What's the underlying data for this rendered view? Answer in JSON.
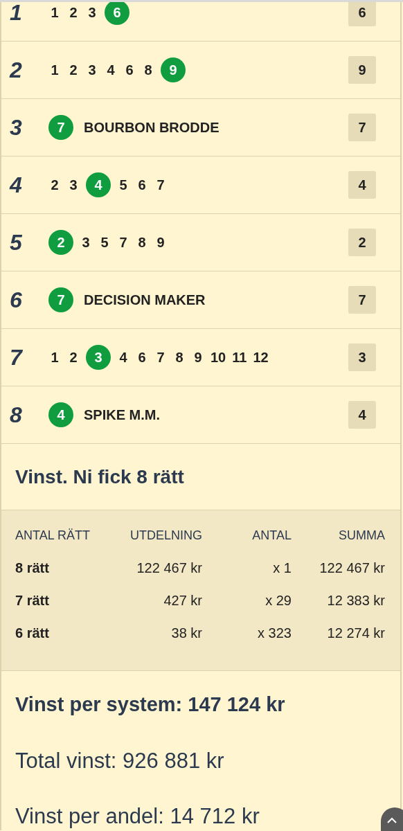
{
  "legs": [
    {
      "number": "1",
      "picks": [
        {
          "label": "1",
          "winner": false
        },
        {
          "label": "2",
          "winner": false
        },
        {
          "label": "3",
          "winner": false
        },
        {
          "label": "6",
          "winner": true
        }
      ],
      "result": "6"
    },
    {
      "number": "2",
      "picks": [
        {
          "label": "1",
          "winner": false
        },
        {
          "label": "2",
          "winner": false
        },
        {
          "label": "3",
          "winner": false
        },
        {
          "label": "4",
          "winner": false
        },
        {
          "label": "6",
          "winner": false
        },
        {
          "label": "8",
          "winner": false
        },
        {
          "label": "9",
          "winner": true
        }
      ],
      "result": "9"
    },
    {
      "number": "3",
      "picks": [
        {
          "label": "7",
          "winner": true
        }
      ],
      "horse": "BOURBON BRODDE",
      "result": "7"
    },
    {
      "number": "4",
      "picks": [
        {
          "label": "2",
          "winner": false
        },
        {
          "label": "3",
          "winner": false
        },
        {
          "label": "4",
          "winner": true
        },
        {
          "label": "5",
          "winner": false
        },
        {
          "label": "6",
          "winner": false
        },
        {
          "label": "7",
          "winner": false
        }
      ],
      "result": "4"
    },
    {
      "number": "5",
      "picks": [
        {
          "label": "2",
          "winner": true
        },
        {
          "label": "3",
          "winner": false
        },
        {
          "label": "5",
          "winner": false
        },
        {
          "label": "7",
          "winner": false
        },
        {
          "label": "8",
          "winner": false
        },
        {
          "label": "9",
          "winner": false
        }
      ],
      "result": "2"
    },
    {
      "number": "6",
      "picks": [
        {
          "label": "7",
          "winner": true
        }
      ],
      "horse": "DECISION MAKER",
      "result": "7"
    },
    {
      "number": "7",
      "picks": [
        {
          "label": "1",
          "winner": false
        },
        {
          "label": "2",
          "winner": false
        },
        {
          "label": "3",
          "winner": true
        },
        {
          "label": "4",
          "winner": false
        },
        {
          "label": "6",
          "winner": false
        },
        {
          "label": "7",
          "winner": false
        },
        {
          "label": "8",
          "winner": false
        },
        {
          "label": "9",
          "winner": false
        },
        {
          "label": "10",
          "winner": false
        },
        {
          "label": "11",
          "winner": false
        },
        {
          "label": "12",
          "winner": false
        }
      ],
      "result": "3"
    },
    {
      "number": "8",
      "picks": [
        {
          "label": "4",
          "winner": true
        }
      ],
      "horse": "SPIKE M.M.",
      "result": "4"
    }
  ],
  "win_title": "Vinst. Ni fick 8 rätt",
  "payout_table": {
    "columns": [
      "ANTAL RÄTT",
      "UTDELNING",
      "ANTAL",
      "SUMMA"
    ],
    "rows": [
      [
        "8 rätt",
        "122 467 kr",
        "x 1",
        "122 467 kr"
      ],
      [
        "7 rätt",
        "427 kr",
        "x 29",
        "12 383 kr"
      ],
      [
        "6 rätt",
        "38 kr",
        "x 323",
        "12 274 kr"
      ]
    ]
  },
  "win_per_system": "Vinst per system: 147 124 kr",
  "total_win": "Total vinst: 926 881 kr",
  "win_per_share": "Vinst per andel: 14 712 kr"
}
